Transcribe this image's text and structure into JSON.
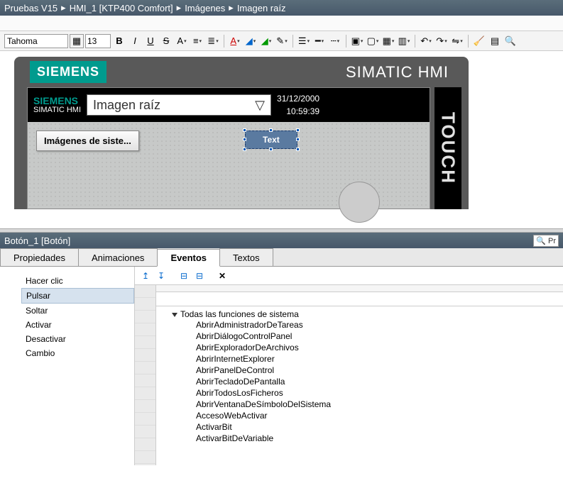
{
  "breadcrumb": [
    "Pruebas V15",
    "HMI_1 [KTP400 Comfort]",
    "Imágenes",
    "Imagen raíz"
  ],
  "toolbar": {
    "font": "Tahoma",
    "size": "13"
  },
  "hmi": {
    "brand": "SIEMENS",
    "title": "SIMATIC HMI",
    "small_brand": "SIEMENS",
    "small_title": "SIMATIC HMI",
    "screen_name": "Imagen raíz",
    "date": "31/12/2000",
    "time": "10:59:39",
    "sys_button": "Imágenes de siste...",
    "text_button": "Text",
    "touch": "TOUCH"
  },
  "inspector": {
    "object": "Botón_1 [Botón]",
    "side_label": "Pr"
  },
  "tabs": [
    "Propiedades",
    "Animaciones",
    "Eventos",
    "Textos"
  ],
  "events": [
    "Hacer clic",
    "Pulsar",
    "Soltar",
    "Activar",
    "Desactivar",
    "Cambio"
  ],
  "selected_event_index": 1,
  "functions": {
    "group": "Todas las funciones de sistema",
    "items": [
      "AbrirAdministradorDeTareas",
      "AbrirDiálogoControlPanel",
      "AbrirExploradorDeArchivos",
      "AbrirInternetExplorer",
      "AbrirPanelDeControl",
      "AbrirTecladoDePantalla",
      "AbrirTodosLosFicheros",
      "AbrirVentanaDeSímboloDelSistema",
      "AccesoWebActivar",
      "ActivarBit",
      "ActivarBitDeVariable"
    ]
  }
}
